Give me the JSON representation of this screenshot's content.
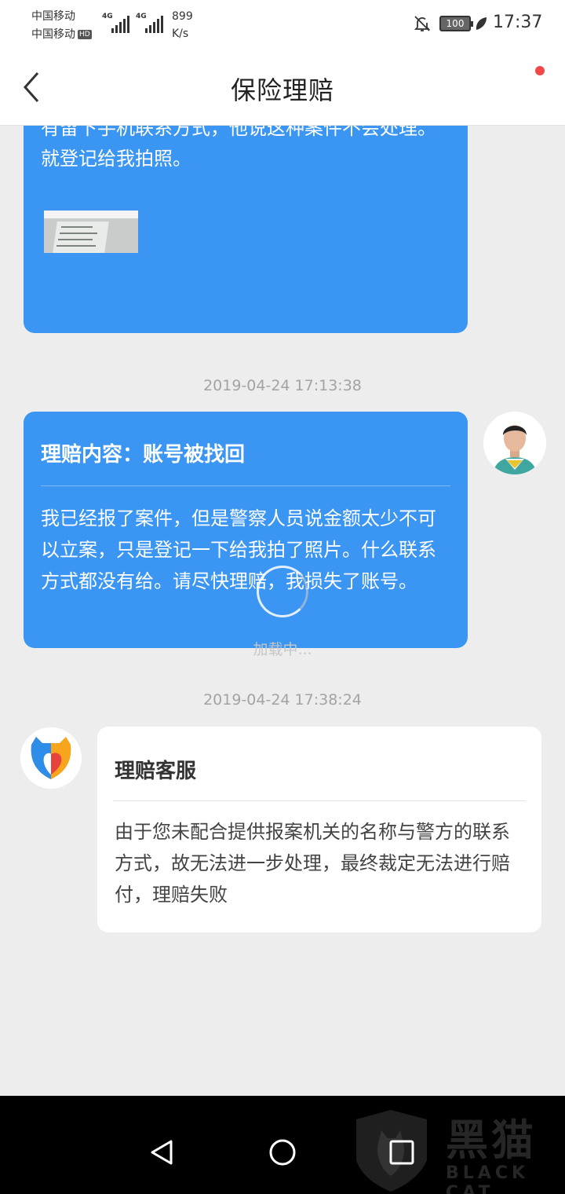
{
  "status_bar": {
    "carrier_1": "中国移动",
    "carrier_2": "中国移动",
    "hd": "HD",
    "network_1": "4G",
    "network_2": "4G",
    "speed_value": "899",
    "speed_unit": "K/s",
    "battery": "100",
    "time": "17:37"
  },
  "nav": {
    "title": "保险理赔"
  },
  "messages": [
    {
      "text": "有留下手机联系方式，他说这种案件不会处理。就登记给我拍照。"
    },
    {
      "timestamp": "2019-04-24 17:13:38",
      "title": "理赔内容：账号被找回",
      "text": "我已经报了案件，但是警察人员说金额太少不可以立案，只是登记一下给我拍了照片。什么联系方式都没有给。请尽快理赔，我损失了账号。"
    },
    {
      "timestamp": "2019-04-24 17:38:24",
      "title": "理赔客服",
      "text": "由于您未配合提供报案机关的名称与警方的联系方式，故无法进一步处理，最终裁定无法进行赔付，理赔失败"
    }
  ],
  "loading": {
    "text": "加载中..."
  },
  "watermark": {
    "text": "黑猫",
    "subtext": "BLACK CAT"
  },
  "colors": {
    "user_bubble": "#3a95f3",
    "service_bubble": "#ffffff",
    "background": "#ededed",
    "notification_dot": "#f04848"
  }
}
